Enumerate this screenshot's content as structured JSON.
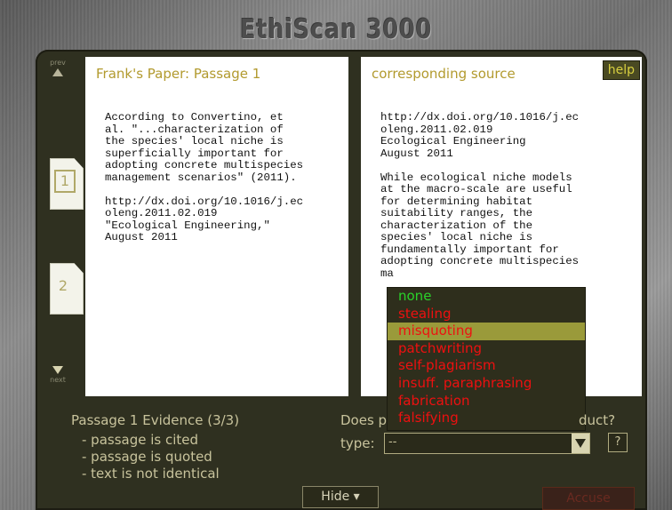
{
  "app": {
    "title": "EthiScan 3000"
  },
  "nav": {
    "prev_label": "prev",
    "next_label": "next"
  },
  "pages": [
    {
      "label": "1"
    },
    {
      "label": "2"
    }
  ],
  "left_card": {
    "title": "Frank's Paper: Passage 1",
    "body": "According to Convertino, et\nal. \"...characterization of\nthe species' local niche is\nsuperficially important for\nadopting concrete multispecies\nmanagement scenarios\" (2011).\n\nhttp://dx.doi.org/10.1016/j.ec\noleng.2011.02.019\n\"Ecological Engineering,\"\nAugust 2011"
  },
  "right_card": {
    "title": "corresponding source",
    "help_label": "help",
    "body": "http://dx.doi.org/10.1016/j.ec\noleng.2011.02.019\nEcological Engineering\nAugust 2011\n\nWhile ecological niche models\nat the macro-scale are useful\nfor determining habitat\nsuitability ranges, the\ncharacterization of the\nspecies' local niche is\nfundamentally important for\nadopting concrete multispecies\nma"
  },
  "dropdown": {
    "items": [
      "none",
      "stealing",
      "misquoting",
      "patchwriting",
      "self-plagiarism",
      "insuff. paraphrasing",
      "fabrication",
      "falsifying"
    ],
    "selected_index": 2
  },
  "evidence": {
    "title": "Passage 1 Evidence (3/3)",
    "items": [
      "- passage is cited",
      "- passage is quoted",
      "- text is not identical"
    ]
  },
  "question": {
    "start": "Does p",
    "end": "duct?"
  },
  "type_field": {
    "label": "type:",
    "value": "--",
    "help_label": "?"
  },
  "buttons": {
    "hide": "Hide ▾",
    "accuse": "Accuse"
  },
  "colors": {
    "panel": "#2f3020",
    "title_text": "#b29a2e",
    "menu_red": "#ee1010",
    "menu_green": "#2ad22a",
    "menu_selected": "#9a9a3a"
  }
}
